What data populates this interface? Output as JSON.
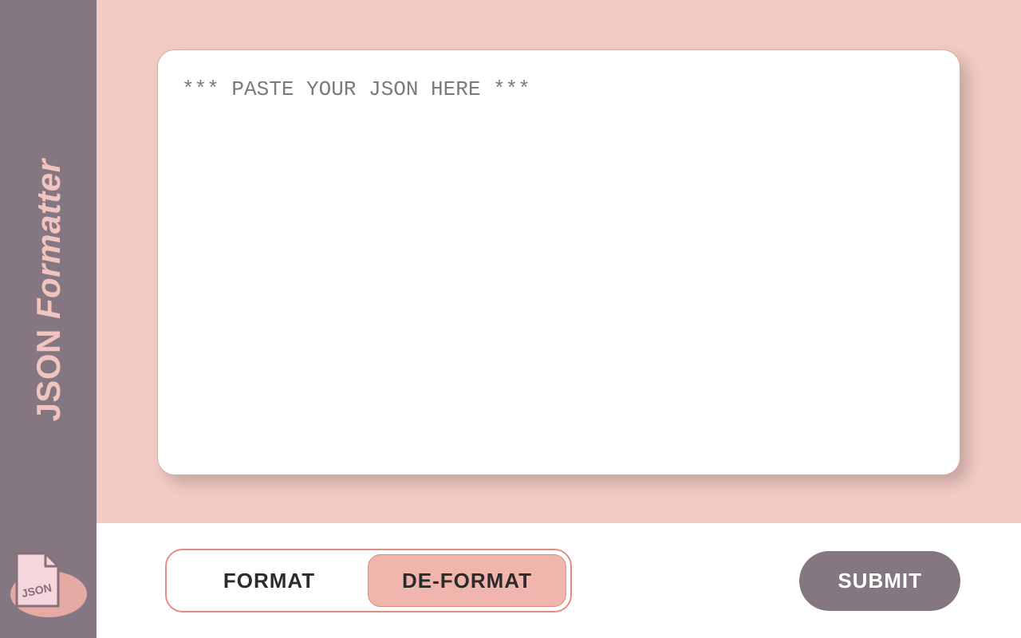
{
  "sidebar": {
    "title_bold": "JSON ",
    "title_italic": "Formatter",
    "icon_label": "JSON"
  },
  "editor": {
    "placeholder": "*** PASTE YOUR JSON HERE ***",
    "value": ""
  },
  "controls": {
    "format_label": "FORMAT",
    "deformat_label": "DE-FORMAT",
    "active": "deformat",
    "submit_label": "SUBMIT"
  }
}
